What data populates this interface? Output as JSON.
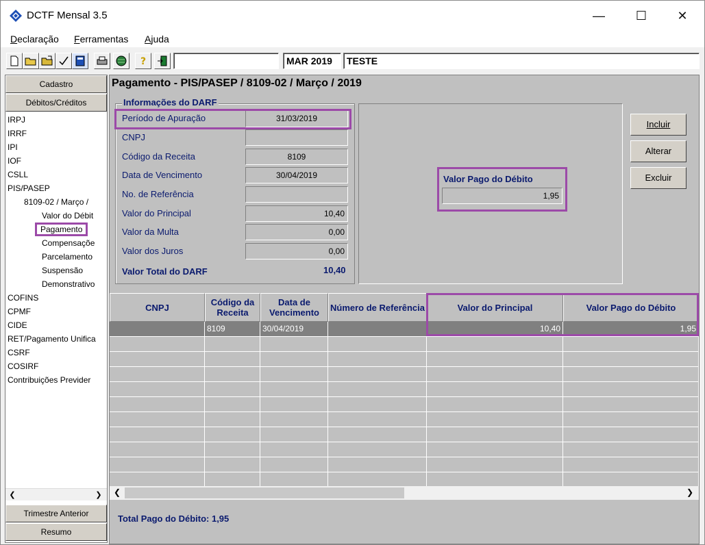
{
  "window": {
    "title": "DCTF Mensal 3.5",
    "min": "—",
    "max": "☐",
    "close": "✕"
  },
  "menu": [
    {
      "label": "Declaração",
      "u": "D",
      "rest": "eclaração"
    },
    {
      "label": "Ferramentas",
      "u": "F",
      "rest": "erramentas"
    },
    {
      "label": "Ajuda",
      "u": "A",
      "rest": "juda"
    }
  ],
  "toolbar": {
    "search_value": "",
    "period": "MAR 2019",
    "company": "TESTE"
  },
  "leftnav": {
    "cadastro": "Cadastro",
    "debitos": "Débitos/Créditos",
    "trimestre": "Trimestre Anterior",
    "resumo": "Resumo",
    "tree": [
      "IRPJ",
      "IRRF",
      "IPI",
      "IOF",
      "CSLL",
      "PIS/PASEP",
      "8109-02 / Março /",
      "Valor do Débit",
      "Pagamento",
      "Compensaçõe",
      "Parcelamento",
      "Suspensão",
      "Demonstrativo",
      "COFINS",
      "CPMF",
      "CIDE",
      "RET/Pagamento Unifica",
      "CSRF",
      "COSIRF",
      "Contribuições Previder"
    ]
  },
  "main": {
    "title": "Pagamento - PIS/PASEP / 8109-02 / Março / 2019",
    "group_title": "Informações do DARF",
    "fields": [
      {
        "label": "Período de Apuração",
        "value": "31/03/2019"
      },
      {
        "label": "CNPJ",
        "value": ""
      },
      {
        "label": "Código da Receita",
        "value": "8109"
      },
      {
        "label": "Data de Vencimento",
        "value": "30/04/2019"
      },
      {
        "label": "No. de Referência",
        "value": ""
      },
      {
        "label": "Valor do Principal",
        "value": "10,40"
      },
      {
        "label": "Valor da Multa",
        "value": "0,00"
      },
      {
        "label": "Valor dos Juros",
        "value": "0,00"
      }
    ],
    "total_label": "Valor Total do DARF",
    "total_value": "10,40",
    "valor_pago_label": "Valor Pago do Débito",
    "valor_pago_value": "1,95",
    "buttons": {
      "incluir": "Incluir",
      "alterar": "Alterar",
      "excluir": "Excluir"
    }
  },
  "grid": {
    "headers": [
      "CNPJ",
      "Código da Receita",
      "Data de Vencimento",
      "Número de Referência",
      "Valor do Principal",
      "Valor Pago do Débito"
    ],
    "rows": [
      [
        "",
        "8109",
        "30/04/2019",
        "",
        "10,40",
        "1,95"
      ]
    ]
  },
  "footer": {
    "total": "Total Pago do Débito: 1,95"
  }
}
